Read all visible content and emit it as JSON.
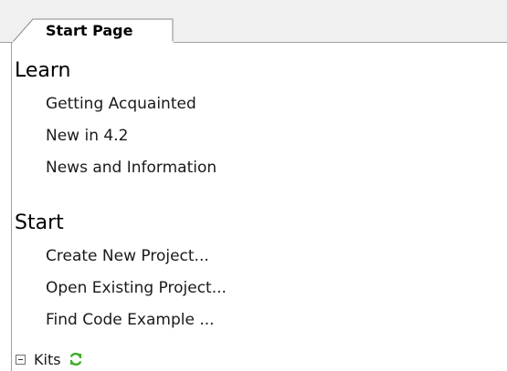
{
  "tab": {
    "label": "Start Page"
  },
  "learn": {
    "heading": "Learn",
    "items": [
      {
        "label": "Getting Acquainted"
      },
      {
        "label": "New in 4.2"
      },
      {
        "label": "News and Information"
      }
    ]
  },
  "start": {
    "heading": "Start",
    "items": [
      {
        "label": "Create New Project..."
      },
      {
        "label": "Open Existing Project..."
      },
      {
        "label": "Find Code Example ..."
      }
    ]
  },
  "kits": {
    "label": "Kits",
    "expander_icon": "collapse-minus-icon",
    "refresh_icon": "refresh-icon",
    "refresh_color": "#3fae2a"
  },
  "colors": {
    "tabstrip_bg": "#f0f0f0",
    "tab_bg": "#ffffff",
    "border": "#a0a0a0"
  }
}
